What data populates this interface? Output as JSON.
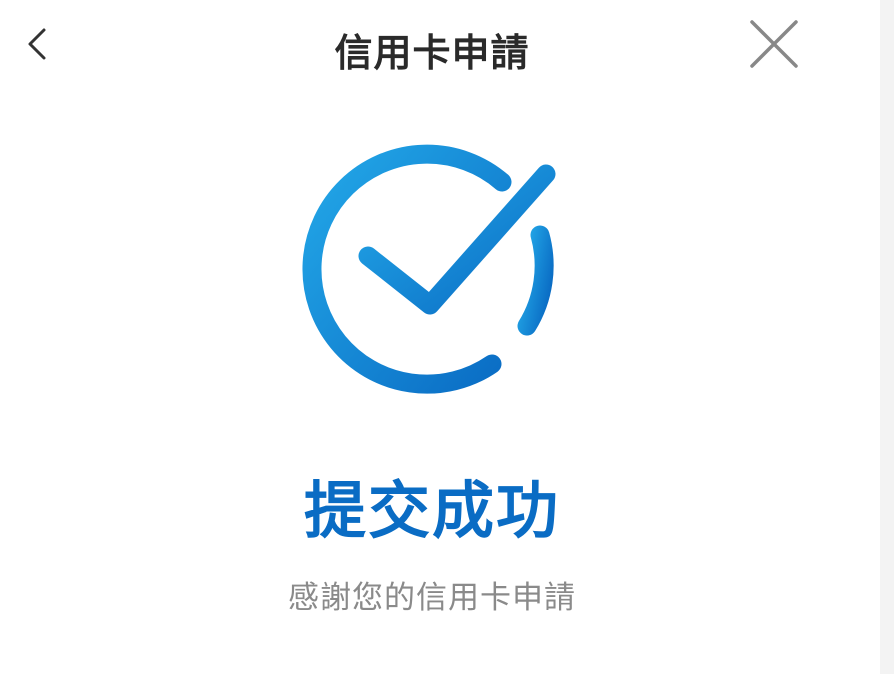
{
  "header": {
    "title": "信用卡申請",
    "back_icon": "chevron-left-icon",
    "close_icon": "close-icon"
  },
  "result": {
    "icon": "check-circle-icon",
    "title": "提交成功",
    "message": "感謝您的信用卡申請"
  },
  "colors": {
    "accent": "#0a6cc4",
    "accent_light": "#1fa3e6",
    "title_text": "#2a2a2a",
    "muted_text": "#8a8a8a",
    "icon_gray": "#888888"
  }
}
